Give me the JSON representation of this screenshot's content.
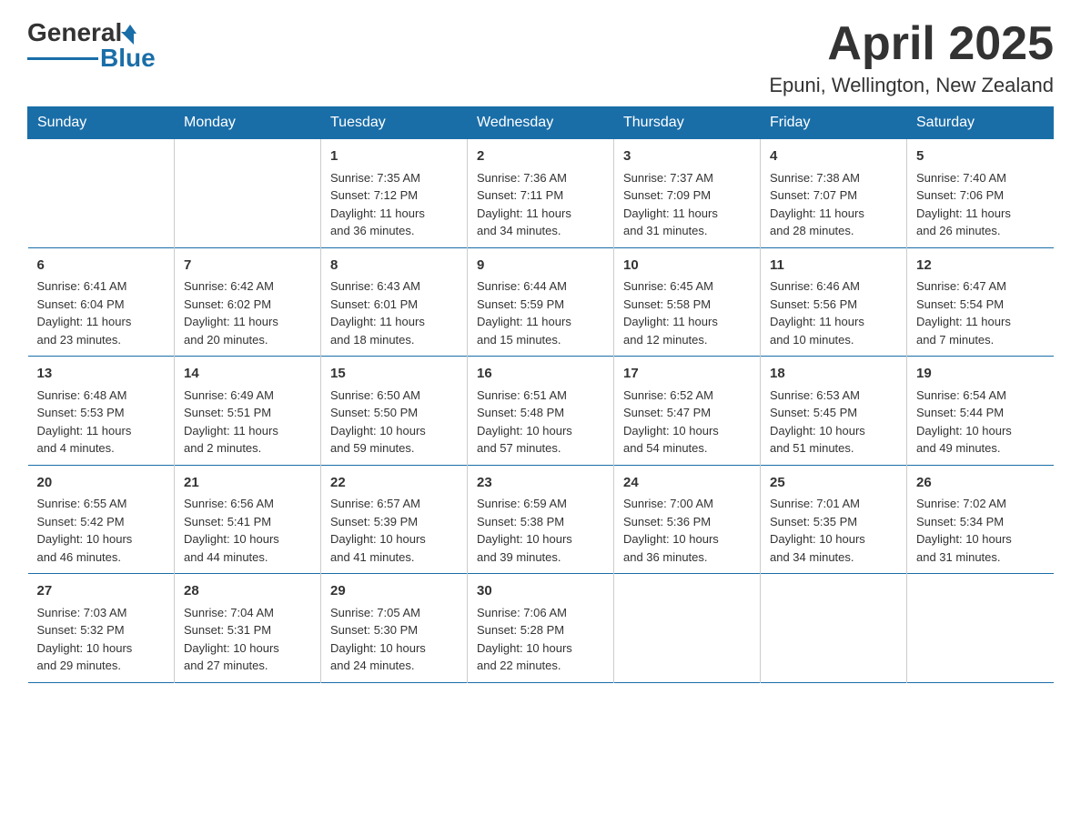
{
  "header": {
    "logo_general": "General",
    "logo_blue": "Blue",
    "title": "April 2025",
    "subtitle": "Epuni, Wellington, New Zealand"
  },
  "days_of_week": [
    "Sunday",
    "Monday",
    "Tuesday",
    "Wednesday",
    "Thursday",
    "Friday",
    "Saturday"
  ],
  "weeks": [
    [
      {
        "day": "",
        "info": ""
      },
      {
        "day": "",
        "info": ""
      },
      {
        "day": "1",
        "info": "Sunrise: 7:35 AM\nSunset: 7:12 PM\nDaylight: 11 hours\nand 36 minutes."
      },
      {
        "day": "2",
        "info": "Sunrise: 7:36 AM\nSunset: 7:11 PM\nDaylight: 11 hours\nand 34 minutes."
      },
      {
        "day": "3",
        "info": "Sunrise: 7:37 AM\nSunset: 7:09 PM\nDaylight: 11 hours\nand 31 minutes."
      },
      {
        "day": "4",
        "info": "Sunrise: 7:38 AM\nSunset: 7:07 PM\nDaylight: 11 hours\nand 28 minutes."
      },
      {
        "day": "5",
        "info": "Sunrise: 7:40 AM\nSunset: 7:06 PM\nDaylight: 11 hours\nand 26 minutes."
      }
    ],
    [
      {
        "day": "6",
        "info": "Sunrise: 6:41 AM\nSunset: 6:04 PM\nDaylight: 11 hours\nand 23 minutes."
      },
      {
        "day": "7",
        "info": "Sunrise: 6:42 AM\nSunset: 6:02 PM\nDaylight: 11 hours\nand 20 minutes."
      },
      {
        "day": "8",
        "info": "Sunrise: 6:43 AM\nSunset: 6:01 PM\nDaylight: 11 hours\nand 18 minutes."
      },
      {
        "day": "9",
        "info": "Sunrise: 6:44 AM\nSunset: 5:59 PM\nDaylight: 11 hours\nand 15 minutes."
      },
      {
        "day": "10",
        "info": "Sunrise: 6:45 AM\nSunset: 5:58 PM\nDaylight: 11 hours\nand 12 minutes."
      },
      {
        "day": "11",
        "info": "Sunrise: 6:46 AM\nSunset: 5:56 PM\nDaylight: 11 hours\nand 10 minutes."
      },
      {
        "day": "12",
        "info": "Sunrise: 6:47 AM\nSunset: 5:54 PM\nDaylight: 11 hours\nand 7 minutes."
      }
    ],
    [
      {
        "day": "13",
        "info": "Sunrise: 6:48 AM\nSunset: 5:53 PM\nDaylight: 11 hours\nand 4 minutes."
      },
      {
        "day": "14",
        "info": "Sunrise: 6:49 AM\nSunset: 5:51 PM\nDaylight: 11 hours\nand 2 minutes."
      },
      {
        "day": "15",
        "info": "Sunrise: 6:50 AM\nSunset: 5:50 PM\nDaylight: 10 hours\nand 59 minutes."
      },
      {
        "day": "16",
        "info": "Sunrise: 6:51 AM\nSunset: 5:48 PM\nDaylight: 10 hours\nand 57 minutes."
      },
      {
        "day": "17",
        "info": "Sunrise: 6:52 AM\nSunset: 5:47 PM\nDaylight: 10 hours\nand 54 minutes."
      },
      {
        "day": "18",
        "info": "Sunrise: 6:53 AM\nSunset: 5:45 PM\nDaylight: 10 hours\nand 51 minutes."
      },
      {
        "day": "19",
        "info": "Sunrise: 6:54 AM\nSunset: 5:44 PM\nDaylight: 10 hours\nand 49 minutes."
      }
    ],
    [
      {
        "day": "20",
        "info": "Sunrise: 6:55 AM\nSunset: 5:42 PM\nDaylight: 10 hours\nand 46 minutes."
      },
      {
        "day": "21",
        "info": "Sunrise: 6:56 AM\nSunset: 5:41 PM\nDaylight: 10 hours\nand 44 minutes."
      },
      {
        "day": "22",
        "info": "Sunrise: 6:57 AM\nSunset: 5:39 PM\nDaylight: 10 hours\nand 41 minutes."
      },
      {
        "day": "23",
        "info": "Sunrise: 6:59 AM\nSunset: 5:38 PM\nDaylight: 10 hours\nand 39 minutes."
      },
      {
        "day": "24",
        "info": "Sunrise: 7:00 AM\nSunset: 5:36 PM\nDaylight: 10 hours\nand 36 minutes."
      },
      {
        "day": "25",
        "info": "Sunrise: 7:01 AM\nSunset: 5:35 PM\nDaylight: 10 hours\nand 34 minutes."
      },
      {
        "day": "26",
        "info": "Sunrise: 7:02 AM\nSunset: 5:34 PM\nDaylight: 10 hours\nand 31 minutes."
      }
    ],
    [
      {
        "day": "27",
        "info": "Sunrise: 7:03 AM\nSunset: 5:32 PM\nDaylight: 10 hours\nand 29 minutes."
      },
      {
        "day": "28",
        "info": "Sunrise: 7:04 AM\nSunset: 5:31 PM\nDaylight: 10 hours\nand 27 minutes."
      },
      {
        "day": "29",
        "info": "Sunrise: 7:05 AM\nSunset: 5:30 PM\nDaylight: 10 hours\nand 24 minutes."
      },
      {
        "day": "30",
        "info": "Sunrise: 7:06 AM\nSunset: 5:28 PM\nDaylight: 10 hours\nand 22 minutes."
      },
      {
        "day": "",
        "info": ""
      },
      {
        "day": "",
        "info": ""
      },
      {
        "day": "",
        "info": ""
      }
    ]
  ]
}
